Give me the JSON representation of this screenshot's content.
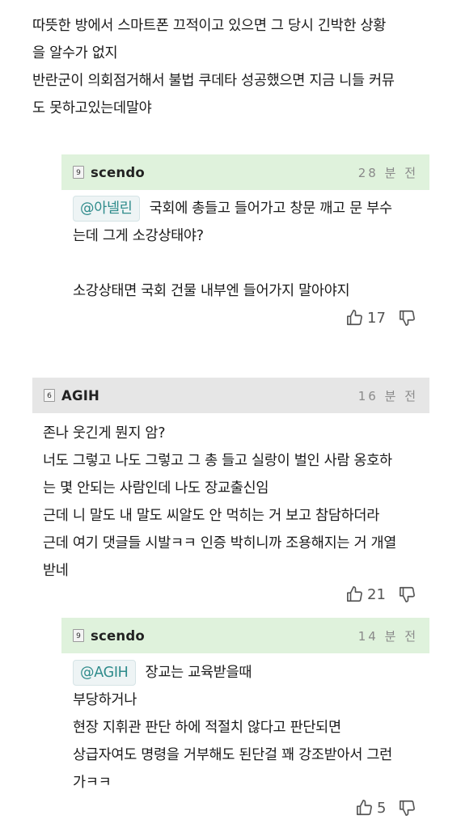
{
  "top_comment": {
    "lines": [
      "따뜻한 방에서 스마트폰 끄적이고 있으면 그 당시 긴박한 상황",
      "을 알수가 없지",
      "반란군이 의회점거해서 불법 쿠데타 성공했으면 지금 니들 커뮤",
      "도 못하고있는데말야"
    ]
  },
  "reply1": {
    "level": "9",
    "nickname": "scendo",
    "time": "28 분 전",
    "mention": "@아넬린",
    "lines": [
      "국회에 총들고 들어가고 창문 깨고 문 부수",
      "는데 그게 소강상태야?",
      "",
      "소강상태면 국회 건물 내부엔 들어가지 말아야지"
    ],
    "likes": "17"
  },
  "comment2": {
    "level": "6",
    "nickname": "AGIH",
    "time": "16 분 전",
    "lines": [
      "존나 웃긴게 뭔지 암?",
      "너도 그렇고 나도 그렇고 그 총 들고 실랑이 벌인 사람 옹호하",
      "는 몇 안되는 사람인데 나도 장교출신임",
      "근데 니 말도 내 말도 씨알도 안 먹히는 거 보고 참담하더라",
      "근데 여기 댓글들 시발ㅋㅋ 인증 박히니까 조용해지는 거 개열",
      "받네"
    ],
    "likes": "21"
  },
  "reply2": {
    "level": "9",
    "nickname": "scendo",
    "time": "14 분 전",
    "mention": "@AGIH",
    "lines": [
      "장교는 교육받을때",
      "부당하거나",
      "현장 지휘관 판단 하에 적절치 않다고 판단되면",
      "상급자여도 명령을 거부해도 된단걸 꽤 강조받아서 그런",
      "가ㅋㅋ"
    ],
    "likes": "5"
  },
  "colors": {
    "reply_header_bg": "#dff2dc",
    "comment_header_bg": "#e6e6e6",
    "mention_text": "#2e8b8b"
  },
  "icons": [
    "thumbs-up-icon",
    "thumbs-down-icon",
    "level-badge-icon"
  ]
}
